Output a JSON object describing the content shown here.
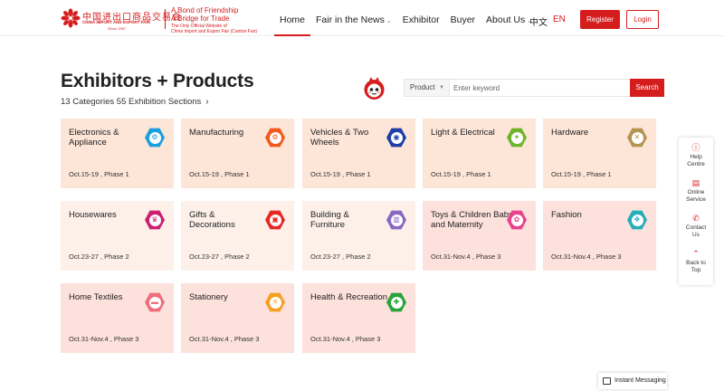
{
  "header": {
    "logo": {
      "cn_text": "中国进出口商品交易会",
      "en_text": "CHINA IMPORT AND EXPORT FAIR",
      "since": "Since 1957"
    },
    "slogan": {
      "line1": "A Bond of Friendship",
      "line2": "A Bridge for Trade",
      "line3a": "The Only Official Website of",
      "line3b": "China Import and Export Fair (Canton Fair)"
    },
    "nav": [
      {
        "label": "Home",
        "active": true,
        "has_menu": false
      },
      {
        "label": "Fair in the News",
        "active": false,
        "has_menu": true
      },
      {
        "label": "Exhibitor",
        "active": false,
        "has_menu": false
      },
      {
        "label": "Buyer",
        "active": false,
        "has_menu": false
      },
      {
        "label": "About Us",
        "active": false,
        "has_menu": true
      }
    ],
    "lang_zh": "中文",
    "lang_en": "EN",
    "register_label": "Register",
    "login_label": "Login"
  },
  "main": {
    "title": "Exhibitors + Products",
    "subtitle": "13 Categories 55 Exhibition Sections",
    "subtitle_arrow": "›",
    "search": {
      "select_value": "Product",
      "placeholder": "Enter keyword",
      "button_label": "Search"
    }
  },
  "categories": [
    {
      "name": "Electronics & Appliance",
      "date": "Oct.15-19 , Phase 1",
      "icon": "electronics-icon",
      "glyph": "⚙",
      "icon_color": "#1aa0e0",
      "bg": "#fde5d8"
    },
    {
      "name": "Manufacturing",
      "date": "Oct.15-19 , Phase 1",
      "icon": "manufacturing-icon",
      "glyph": "⚙",
      "icon_color": "#f05a1e",
      "bg": "#fde5d8"
    },
    {
      "name": "Vehicles & Two Wheels",
      "date": "Oct.15-19 , Phase 1",
      "icon": "vehicle-icon",
      "glyph": "◉",
      "icon_color": "#1f3fa8",
      "bg": "#fde5d8"
    },
    {
      "name": "Light & Electrical",
      "date": "Oct.15-19 , Phase 1",
      "icon": "lightbulb-icon",
      "glyph": "✦",
      "icon_color": "#6fb52c",
      "bg": "#fde5d8"
    },
    {
      "name": "Hardware",
      "date": "Oct.15-19 , Phase 1",
      "icon": "tools-icon",
      "glyph": "✕",
      "icon_color": "#b39450",
      "bg": "#fde5d8"
    },
    {
      "name": "Housewares",
      "date": "Oct.23-27 , Phase 2",
      "icon": "basket-icon",
      "glyph": "♛",
      "icon_color": "#cc1f72",
      "bg": "#fcf0e9"
    },
    {
      "name": "Gifts & Decorations",
      "date": "Oct.23-27 , Phase 2",
      "icon": "gift-icon",
      "glyph": "▣",
      "icon_color": "#e52a26",
      "bg": "#fcf0e9"
    },
    {
      "name": "Building & Furniture",
      "date": "Oct.23-27 , Phase 2",
      "icon": "building-icon",
      "glyph": "▥",
      "icon_color": "#8a68c2",
      "bg": "#fcf0e9"
    },
    {
      "name": "Toys & Children Baby and Maternity",
      "date": "Oct.31-Nov.4 , Phase 3",
      "icon": "stroller-icon",
      "glyph": "✿",
      "icon_color": "#e8428c",
      "bg": "#fde1dc"
    },
    {
      "name": "Fashion",
      "date": "Oct.31-Nov.4 , Phase 3",
      "icon": "shirt-icon",
      "glyph": "❖",
      "icon_color": "#23aeb9",
      "bg": "#fde1dc"
    },
    {
      "name": "Home Textiles",
      "date": "Oct.31-Nov.4 , Phase 3",
      "icon": "bed-icon",
      "glyph": "▬",
      "icon_color": "#ef6f7c",
      "bg": "#fde1dc"
    },
    {
      "name": "Stationery",
      "date": "Oct.31-Nov.4 , Phase 3",
      "icon": "pencil-ruler-icon",
      "glyph": "✕",
      "icon_color": "#f5a020",
      "bg": "#fde1dc"
    },
    {
      "name": "Health & Recreation",
      "date": "Oct.31-Nov.4 , Phase 3",
      "icon": "health-icon",
      "glyph": "✚",
      "icon_color": "#27a53a",
      "bg": "#fde1dc"
    }
  ],
  "sidebar": {
    "help_line1": "Help",
    "help_line2": "Centre",
    "online_line1": "Online",
    "online_line2": "Service",
    "contact_line1": "Contact",
    "contact_line2": "Us",
    "top_line1": "Back to",
    "top_line2": "Top"
  },
  "im_label": "Instant Messaging",
  "colors": {
    "brand_red": "#d61d1d"
  }
}
